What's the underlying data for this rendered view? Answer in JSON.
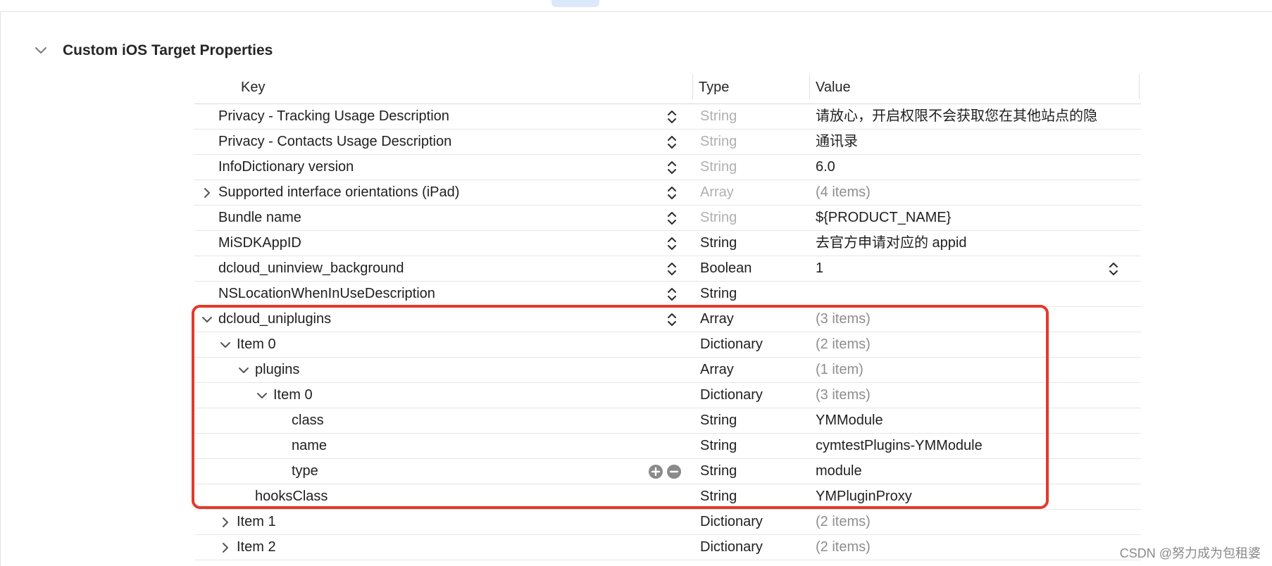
{
  "section": {
    "title": "Custom iOS Target Properties"
  },
  "columns": {
    "key": "Key",
    "type": "Type",
    "value": "Value"
  },
  "rows": [
    {
      "level": 0,
      "disclosure": "none",
      "key": "Privacy - Tracking Usage Description",
      "control": "stepper",
      "type": "String",
      "type_dim": true,
      "value": "请放心，开启权限不会获取您在其他站点的隐",
      "value_dim": false
    },
    {
      "level": 0,
      "disclosure": "none",
      "key": "Privacy - Contacts Usage Description",
      "control": "stepper",
      "type": "String",
      "type_dim": true,
      "value": "通讯录",
      "value_dim": false
    },
    {
      "level": 0,
      "disclosure": "none",
      "key": "InfoDictionary version",
      "control": "stepper",
      "type": "String",
      "type_dim": true,
      "value": "6.0",
      "value_dim": false
    },
    {
      "level": 0,
      "disclosure": "right",
      "key": "Supported interface orientations (iPad)",
      "control": "stepper",
      "type": "Array",
      "type_dim": true,
      "value": "(4 items)",
      "value_dim": true
    },
    {
      "level": 0,
      "disclosure": "none",
      "key": "Bundle name",
      "control": "stepper",
      "type": "String",
      "type_dim": true,
      "value": "${PRODUCT_NAME}",
      "value_dim": false
    },
    {
      "level": 0,
      "disclosure": "none",
      "key": "MiSDKAppID",
      "control": "stepper",
      "type": "String",
      "type_dim": false,
      "value": "去官方申请对应的 appid",
      "value_dim": false
    },
    {
      "level": 0,
      "disclosure": "none",
      "key": "dcloud_uninview_background",
      "control": "stepper",
      "type": "Boolean",
      "type_dim": false,
      "value": "1",
      "value_dim": false,
      "value_stepper": true
    },
    {
      "level": 0,
      "disclosure": "none",
      "key": "NSLocationWhenInUseDescription",
      "control": "stepper",
      "type": "String",
      "type_dim": false,
      "value": "",
      "value_dim": false
    },
    {
      "level": 0,
      "disclosure": "down",
      "key": "dcloud_uniplugins",
      "control": "stepper",
      "type": "Array",
      "type_dim": false,
      "value": "(3 items)",
      "value_dim": true
    },
    {
      "level": 1,
      "disclosure": "down",
      "key": "Item 0",
      "control": "none",
      "type": "Dictionary",
      "type_dim": false,
      "value": "(2 items)",
      "value_dim": true
    },
    {
      "level": 2,
      "disclosure": "down",
      "key": "plugins",
      "control": "none",
      "type": "Array",
      "type_dim": false,
      "value": "(1 item)",
      "value_dim": true
    },
    {
      "level": 3,
      "disclosure": "down",
      "key": "Item 0",
      "control": "none",
      "type": "Dictionary",
      "type_dim": false,
      "value": "(3 items)",
      "value_dim": true
    },
    {
      "level": 4,
      "disclosure": "none",
      "key": "class",
      "control": "none",
      "type": "String",
      "type_dim": false,
      "value": "YMModule",
      "value_dim": false
    },
    {
      "level": 4,
      "disclosure": "none",
      "key": "name",
      "control": "none",
      "type": "String",
      "type_dim": false,
      "value": "cymtestPlugins-YMModule",
      "value_dim": false
    },
    {
      "level": 4,
      "disclosure": "none",
      "key": "type",
      "control": "plusminus",
      "type": "String",
      "type_dim": false,
      "value": "module",
      "value_dim": false
    },
    {
      "level": 2,
      "disclosure": "none",
      "key": "hooksClass",
      "control": "none",
      "type": "String",
      "type_dim": false,
      "value": "YMPluginProxy",
      "value_dim": false
    },
    {
      "level": 1,
      "disclosure": "right",
      "key": "Item 1",
      "control": "none",
      "type": "Dictionary",
      "type_dim": false,
      "value": "(2 items)",
      "value_dim": true
    },
    {
      "level": 1,
      "disclosure": "right",
      "key": "Item 2",
      "control": "none",
      "type": "Dictionary",
      "type_dim": false,
      "value": "(2 items)",
      "value_dim": true
    }
  ],
  "colors": {
    "highlight": "#e13a2b",
    "dim_text": "#b0b0b0",
    "secondary_text": "#8e8e8e"
  },
  "watermark": "CSDN @努力成为包租婆"
}
